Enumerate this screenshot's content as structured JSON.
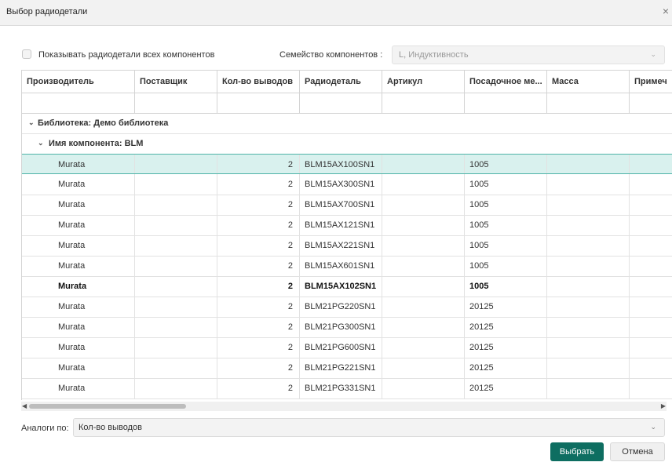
{
  "dialog": {
    "title": "Выбор радиодетали",
    "close_glyph": "×"
  },
  "options": {
    "show_all_label": "Показывать радиодетали всех компонентов",
    "show_all_checked": false,
    "family_label": "Семейство компонентов :",
    "family_value": "L, Индуктивность"
  },
  "table": {
    "columns": [
      "Производитель",
      "Поставщик",
      "Кол-во выводов",
      "Радиодеталь",
      "Артикул",
      "Посадочное ме...",
      "Масса",
      "Примеч"
    ],
    "groups": {
      "library": "Библиотека: Демо библиотека",
      "component": "Имя компонента: BLM"
    },
    "rows": [
      {
        "manufacturer": "Murata",
        "supplier": "",
        "pins": "2",
        "part": "BLM15AX100SN1",
        "article": "",
        "footprint": "1005",
        "mass": "",
        "note": ""
      },
      {
        "manufacturer": "Murata",
        "supplier": "",
        "pins": "2",
        "part": "BLM15AX300SN1",
        "article": "",
        "footprint": "1005",
        "mass": "",
        "note": ""
      },
      {
        "manufacturer": "Murata",
        "supplier": "",
        "pins": "2",
        "part": "BLM15AX700SN1",
        "article": "",
        "footprint": "1005",
        "mass": "",
        "note": ""
      },
      {
        "manufacturer": "Murata",
        "supplier": "",
        "pins": "2",
        "part": "BLM15AX121SN1",
        "article": "",
        "footprint": "1005",
        "mass": "",
        "note": ""
      },
      {
        "manufacturer": "Murata",
        "supplier": "",
        "pins": "2",
        "part": "BLM15AX221SN1",
        "article": "",
        "footprint": "1005",
        "mass": "",
        "note": ""
      },
      {
        "manufacturer": "Murata",
        "supplier": "",
        "pins": "2",
        "part": "BLM15AX601SN1",
        "article": "",
        "footprint": "1005",
        "mass": "",
        "note": ""
      },
      {
        "manufacturer": "Murata",
        "supplier": "",
        "pins": "2",
        "part": "BLM15AX102SN1",
        "article": "",
        "footprint": "1005",
        "mass": "",
        "note": ""
      },
      {
        "manufacturer": "Murata",
        "supplier": "",
        "pins": "2",
        "part": "BLM21PG220SN1",
        "article": "",
        "footprint": "20125",
        "mass": "",
        "note": ""
      },
      {
        "manufacturer": "Murata",
        "supplier": "",
        "pins": "2",
        "part": "BLM21PG300SN1",
        "article": "",
        "footprint": "20125",
        "mass": "",
        "note": ""
      },
      {
        "manufacturer": "Murata",
        "supplier": "",
        "pins": "2",
        "part": "BLM21PG600SN1",
        "article": "",
        "footprint": "20125",
        "mass": "",
        "note": ""
      },
      {
        "manufacturer": "Murata",
        "supplier": "",
        "pins": "2",
        "part": "BLM21PG221SN1",
        "article": "",
        "footprint": "20125",
        "mass": "",
        "note": ""
      },
      {
        "manufacturer": "Murata",
        "supplier": "",
        "pins": "2",
        "part": "BLM21PG331SN1",
        "article": "",
        "footprint": "20125",
        "mass": "",
        "note": ""
      }
    ],
    "selected_row": 0,
    "bold_row": 6
  },
  "analogs": {
    "label": "Аналоги по:",
    "value": "Кол-во выводов"
  },
  "buttons": {
    "ok": "Выбрать",
    "cancel": "Отмена"
  },
  "colors": {
    "primary": "#0e6e61",
    "selection": "#d9f1ee",
    "selection_border": "#4fb3a8"
  }
}
